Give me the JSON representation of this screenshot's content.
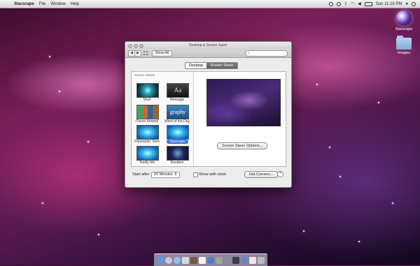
{
  "menubar": {
    "apple_glyph": "",
    "app_name": "Starscape",
    "items": [
      "File",
      "Window",
      "Help"
    ],
    "clock": "Sun 11:19 PM"
  },
  "desktop_icons": [
    {
      "label": "Starscape",
      "icon": "starscape-sphere-icon"
    },
    {
      "label": "Images",
      "icon": "folder-icon"
    }
  ],
  "window": {
    "title": "Desktop & Screen Saver",
    "nav_back": "◀",
    "nav_forward": "▶",
    "show_all_label": "Show All",
    "search_placeholder": "",
    "tabs": [
      {
        "label": "Desktop",
        "active": false
      },
      {
        "label": "Screen Saver",
        "active": true
      }
    ],
    "list_header": "Screen Savers",
    "savers": [
      {
        "label": "Shell",
        "thumb": "shell",
        "selected": false
      },
      {
        "label": "Message",
        "thumb": "message",
        "glyph": "Aa",
        "selected": false
      },
      {
        "label": "iTunes Artwork",
        "thumb": "itunes",
        "selected": false
      },
      {
        "label": "Word of the Day",
        "thumb": "word",
        "glyph": "graphy",
        "selected": false
      },
      {
        "label": "Panoramic View",
        "thumb": "blue",
        "selected": false
      },
      {
        "label": "Starscape",
        "thumb": "blue",
        "selected": true
      },
      {
        "label": "Textify Me",
        "thumb": "blue",
        "selected": false
      },
      {
        "label": "Random",
        "thumb": "random",
        "selected": false
      }
    ],
    "options_button": "Screen Saver Options...",
    "start_after_label": "Start after:",
    "start_after_value": "20 Minutes",
    "show_clock_label": "Show with clock",
    "show_clock_checked": false,
    "hot_corners_button": "Hot Corners...",
    "help_glyph": "?"
  },
  "colors": {
    "selection": "#3875d7",
    "accent_tab": "#6b6b6b"
  }
}
